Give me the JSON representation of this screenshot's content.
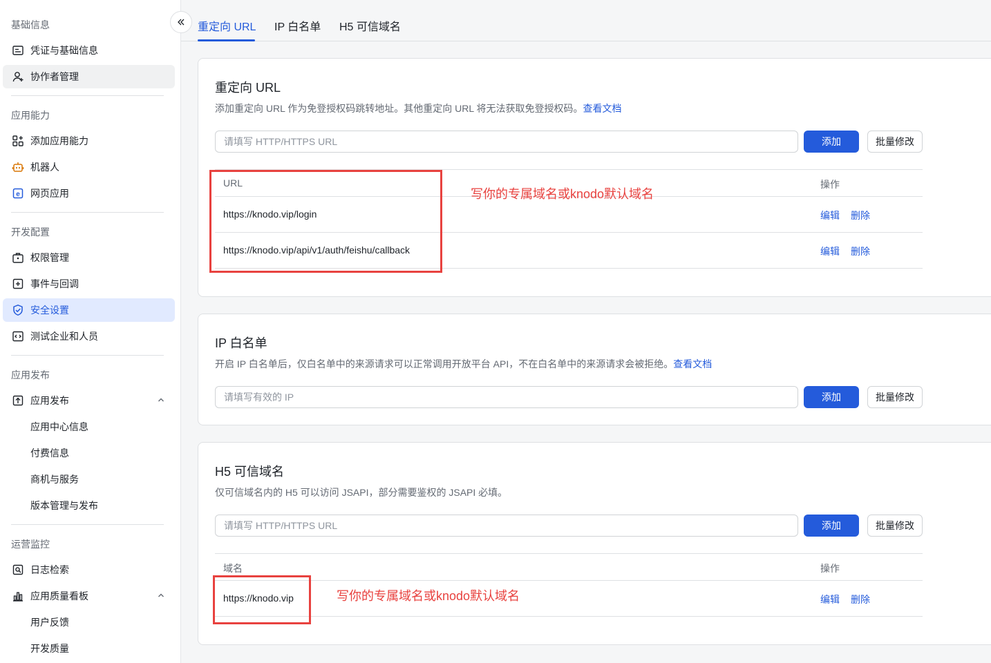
{
  "sidebar": {
    "sections": [
      {
        "title": "基础信息",
        "items": [
          {
            "label": "凭证与基础信息",
            "icon": "credential-icon"
          },
          {
            "label": "协作者管理",
            "icon": "add-user-icon"
          }
        ]
      },
      {
        "title": "应用能力",
        "items": [
          {
            "label": "添加应用能力",
            "icon": "apps-icon"
          },
          {
            "label": "机器人",
            "icon": "robot-icon"
          },
          {
            "label": "网页应用",
            "icon": "web-app-icon"
          }
        ]
      },
      {
        "title": "开发配置",
        "items": [
          {
            "label": "权限管理",
            "icon": "briefcase-lock-icon"
          },
          {
            "label": "事件与回调",
            "icon": "event-icon"
          },
          {
            "label": "安全设置",
            "icon": "shield-check-icon"
          },
          {
            "label": "测试企业和人员",
            "icon": "test-code-icon"
          }
        ]
      },
      {
        "title": "应用发布",
        "items": [
          {
            "label": "应用发布",
            "icon": "upload-icon"
          },
          {
            "label": "应用中心信息"
          },
          {
            "label": "付费信息"
          },
          {
            "label": "商机与服务"
          },
          {
            "label": "版本管理与发布"
          }
        ]
      },
      {
        "title": "运营监控",
        "items": [
          {
            "label": "日志检索",
            "icon": "log-search-icon"
          },
          {
            "label": "应用质量看板",
            "icon": "bar-chart-icon"
          },
          {
            "label": "用户反馈"
          },
          {
            "label": "开发质量"
          }
        ]
      }
    ]
  },
  "tabs": [
    {
      "label": "重定向 URL"
    },
    {
      "label": "IP 白名单"
    },
    {
      "label": "H5 可信域名"
    }
  ],
  "redirect": {
    "title": "重定向 URL",
    "desc": "添加重定向 URL 作为免登授权码跳转地址。其他重定向 URL 将无法获取免登授权码。",
    "doc_link": "查看文档",
    "placeholder": "请填写 HTTP/HTTPS URL",
    "add_label": "添加",
    "bulk_label": "批量修改",
    "col_url": "URL",
    "col_action": "操作",
    "rows": [
      {
        "url": "https://knodo.vip/login",
        "edit": "编辑",
        "delete": "删除"
      },
      {
        "url": "https://knodo.vip/api/v1/auth/feishu/callback",
        "edit": "编辑",
        "delete": "删除"
      }
    ],
    "annotation": "写你的专属域名或knodo默认域名"
  },
  "ip": {
    "title": "IP 白名单",
    "desc": "开启 IP 白名单后，仅白名单中的来源请求可以正常调用开放平台 API，不在白名单中的来源请求会被拒绝。",
    "doc_link": "查看文档",
    "placeholder": "请填写有效的 IP",
    "add_label": "添加",
    "bulk_label": "批量修改"
  },
  "h5": {
    "title": "H5 可信域名",
    "desc": "仅可信域名内的 H5 可以访问 JSAPI，部分需要鉴权的 JSAPI 必填。",
    "placeholder": "请填写 HTTP/HTTPS URL",
    "add_label": "添加",
    "bulk_label": "批量修改",
    "col_domain": "域名",
    "col_action": "操作",
    "rows": [
      {
        "domain": "https://knodo.vip",
        "edit": "编辑",
        "delete": "删除"
      }
    ],
    "annotation": "写你的专属域名或knodo默认域名"
  },
  "colors": {
    "accent": "#245bdb",
    "annotation_red": "#e8423f",
    "active_bg": "#e1eaff"
  }
}
